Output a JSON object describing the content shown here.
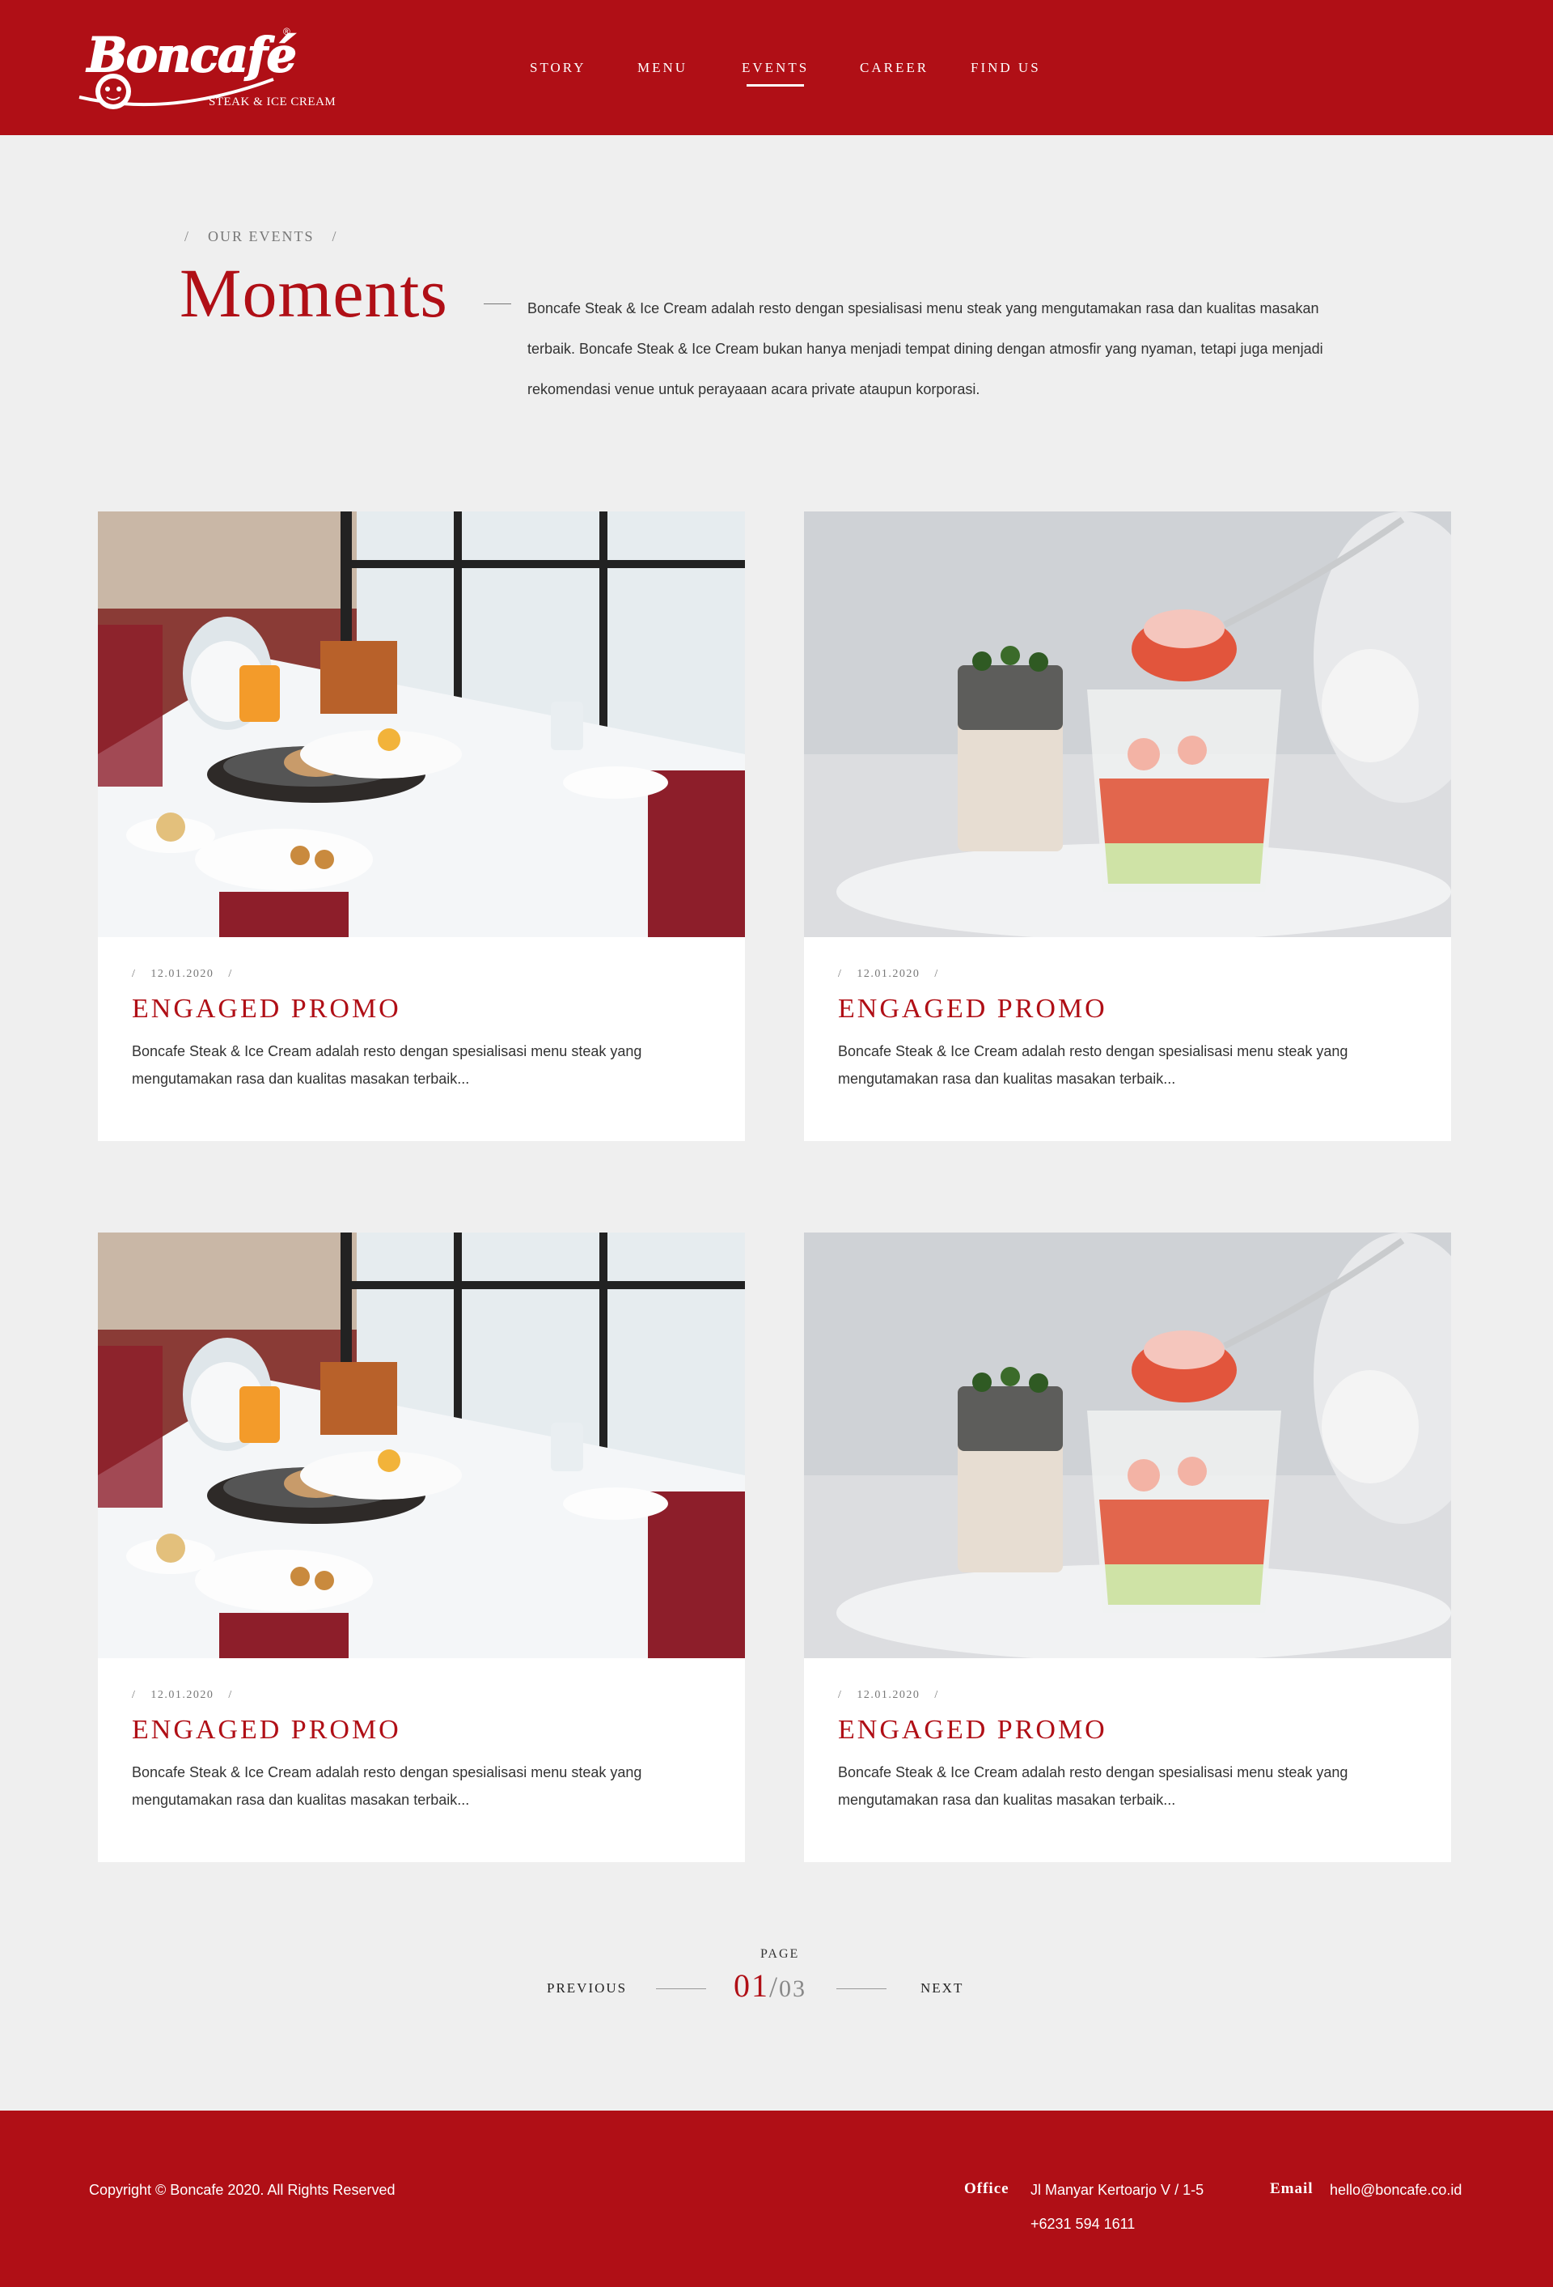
{
  "header": {
    "logo_word": "Boncafé",
    "logo_sub": "STEAK & ICE CREAM",
    "logo_reg": "®",
    "nav": [
      "STORY",
      "MENU",
      "EVENTS",
      "CAREER",
      "FIND US"
    ],
    "active_nav": "EVENTS",
    "brand_color": "#b00f16"
  },
  "intro": {
    "crumb": "OUR EVENTS",
    "title": "Moments",
    "text": "Boncafe Steak & Ice Cream adalah resto dengan spesialisasi menu steak yang mengutamakan rasa dan kualitas masakan terbaik. Boncafe Steak & Ice Cream bukan hanya menjadi tempat dining dengan atmosfir yang nyaman, tetapi juga menjadi rekomendasi venue untuk perayaaan acara private ataupun korporasi."
  },
  "cards": [
    {
      "date": "12.01.2020",
      "title": "ENGAGED PROMO",
      "desc": "Boncafe Steak & Ice Cream adalah resto dengan spesialisasi menu steak yang mengutamakan rasa dan kualitas masakan terbaik...",
      "image": "table-setting"
    },
    {
      "date": "12.01.2020",
      "title": "ENGAGED PROMO",
      "desc": "Boncafe Steak & Ice Cream adalah resto dengan spesialisasi menu steak yang mengutamakan rasa dan kualitas masakan terbaik...",
      "image": "dessert-glass"
    },
    {
      "date": "12.01.2020",
      "title": "ENGAGED PROMO",
      "desc": "Boncafe Steak & Ice Cream adalah resto dengan spesialisasi menu steak yang mengutamakan rasa dan kualitas masakan terbaik...",
      "image": "table-setting"
    },
    {
      "date": "12.01.2020",
      "title": "ENGAGED PROMO",
      "desc": "Boncafe Steak & Ice Cream adalah resto dengan spesialisasi menu steak yang mengutamakan rasa dan kualitas masakan terbaik...",
      "image": "dessert-glass"
    }
  ],
  "pagination": {
    "label": "PAGE",
    "prev": "PREVIOUS",
    "next": "NEXT",
    "current": "01",
    "separator": "/",
    "total": "03"
  },
  "footer": {
    "copyright": "Copyright © Boncafe 2020. All Rights Reserved",
    "office_label": "Office",
    "office_address": "Jl Manyar Kertoarjo V / 1-5",
    "office_phone": "+6231 594 1611",
    "email_label": "Email",
    "email": "hello@boncafe.co.id"
  }
}
